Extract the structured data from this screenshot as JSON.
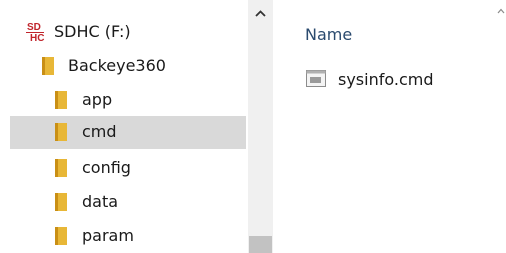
{
  "nav": {
    "drive": {
      "label": "SDHC (F:)",
      "icon": "sd-card-drive-icon",
      "icon_text_top": "SD",
      "icon_text_bottom": "HC"
    },
    "root_folder": {
      "label": "Backeye360",
      "icon": "folder-icon"
    },
    "folders": [
      {
        "label": "app",
        "icon": "folder-icon"
      },
      {
        "label": "cmd",
        "icon": "folder-icon",
        "selected": true
      },
      {
        "label": "config",
        "icon": "folder-icon"
      },
      {
        "label": "data",
        "icon": "folder-icon"
      },
      {
        "label": "param",
        "icon": "folder-icon"
      }
    ]
  },
  "content": {
    "column_header": "Name",
    "files": [
      {
        "name": "sysinfo.cmd",
        "icon": "cmd-file-icon"
      }
    ]
  },
  "colors": {
    "selection": "#d9d9d9",
    "folder": "#e8b737",
    "header_text": "#2a4a6e",
    "drive_red": "#c0242b"
  }
}
